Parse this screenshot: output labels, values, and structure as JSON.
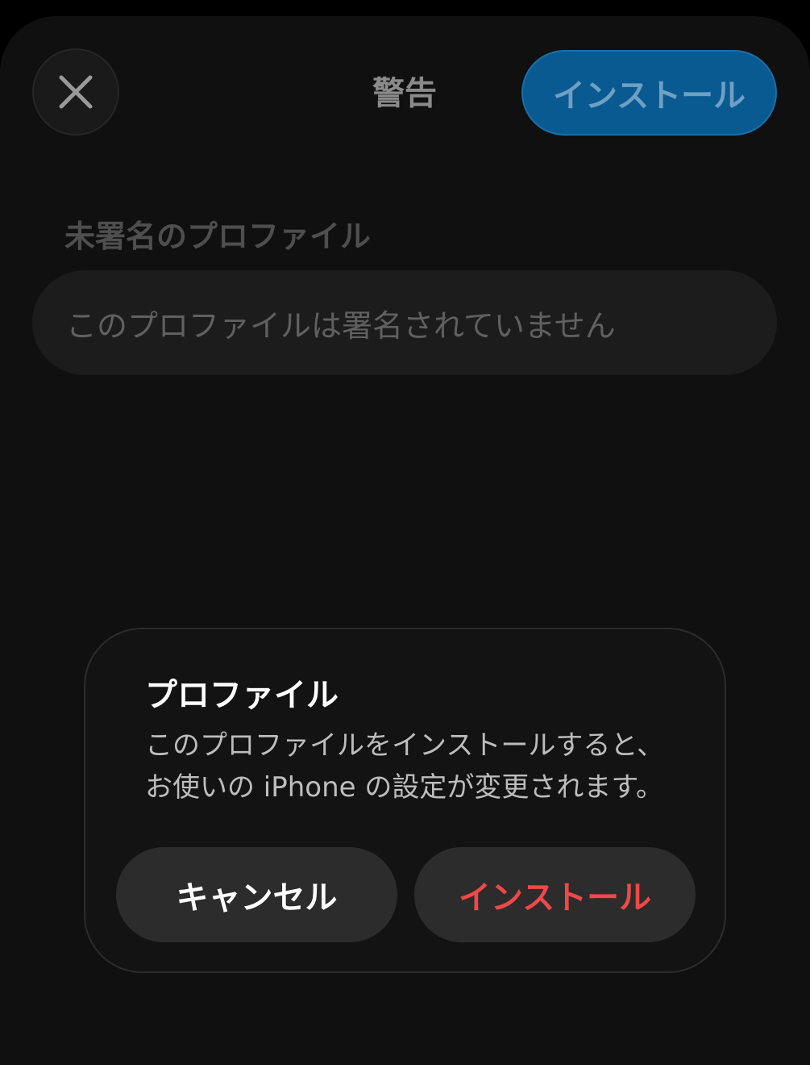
{
  "nav": {
    "title": "警告",
    "install_label": "インストール",
    "close_icon": "close-icon"
  },
  "section": {
    "header": "未署名のプロファイル",
    "info_text": "このプロファイルは署名されていません"
  },
  "alert": {
    "title": "プロファイル",
    "message_line1": "このプロファイルをインストールすると、",
    "message_line2": "お使いの iPhone の設定が変更されます。",
    "cancel_label": "キャンセル",
    "install_label": "インストール"
  },
  "colors": {
    "accent_blue": "#0a5a92",
    "destructive_red": "#f04848",
    "background": "#101010"
  }
}
